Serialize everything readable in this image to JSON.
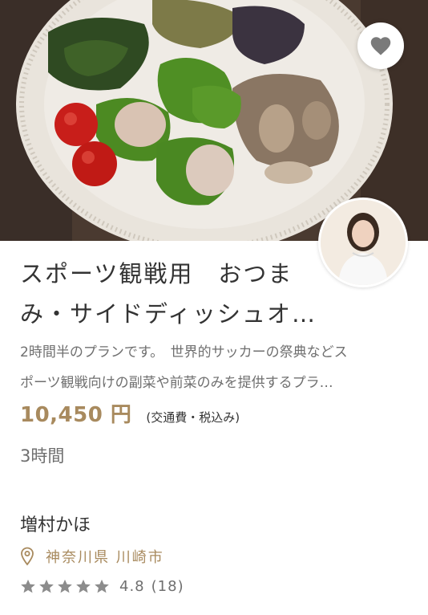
{
  "listing": {
    "title_line1": "スポーツ観戦用　おつま",
    "title_line2": "み・サイドディッシュオ…",
    "description_line1": "2時間半のプランです。　世界的サッカーの祭典などス",
    "description_line2": "ポーツ観戦向けの副菜や前菜のみを提供するプラ…",
    "price": "10,450 円",
    "price_note": "(交通費・税込み)",
    "duration": "3時間",
    "chef_name": "増村かほ",
    "location": "神奈川県 川崎市",
    "rating": "4.8",
    "review_count": "(18)",
    "stars_filled": 5
  },
  "icons": {
    "favorite": "heart-icon",
    "location": "location-pin-icon",
    "star": "star-icon"
  },
  "colors": {
    "accent": "#a88a5e",
    "text": "#333333",
    "muted": "#6f6f6f",
    "star": "#8c8c8c"
  }
}
